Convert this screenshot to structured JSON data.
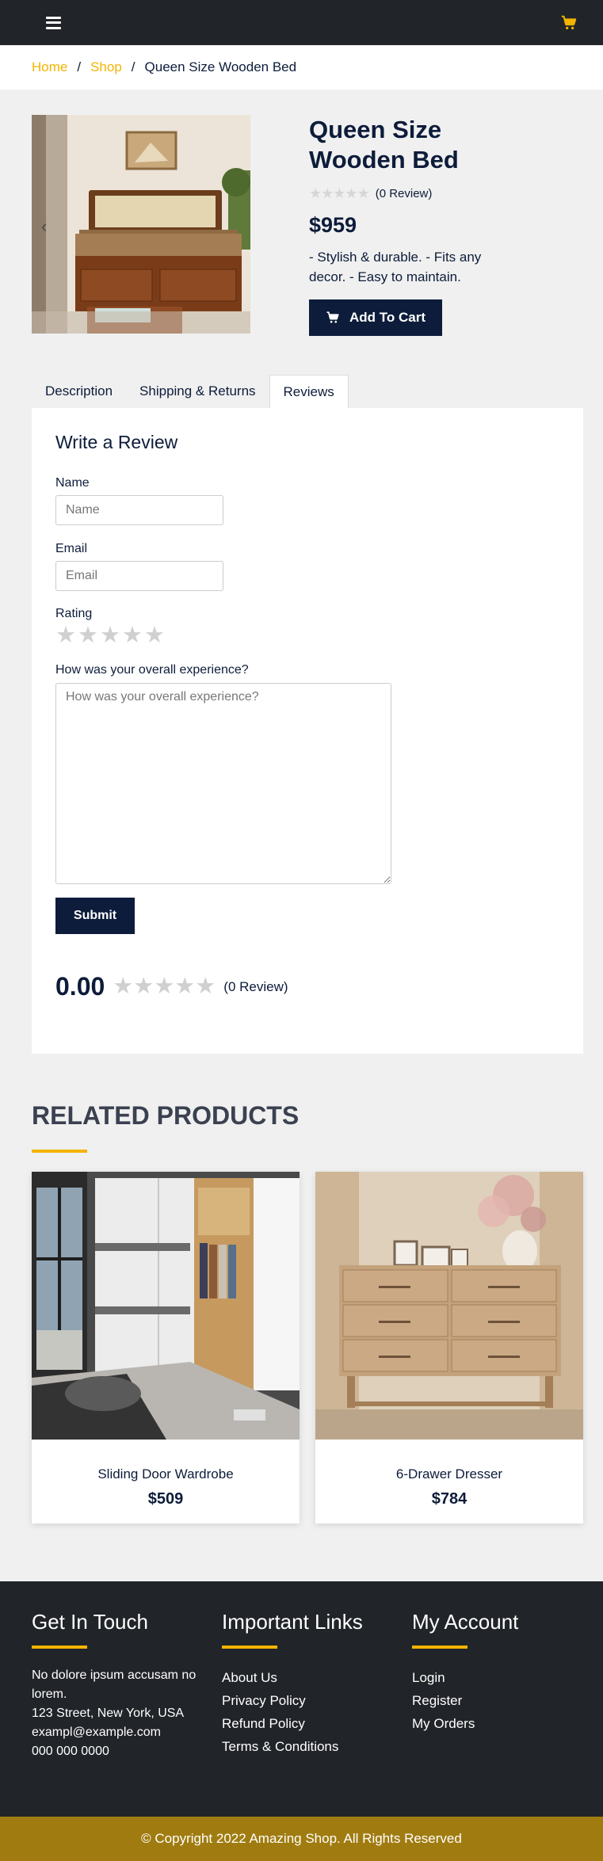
{
  "nav": {
    "menu_icon": "hamburger-menu-icon",
    "cart_icon": "shopping-cart-icon",
    "accent_color": "#f4b400",
    "dark_color": "#212428"
  },
  "breadcrumb": {
    "home": "Home",
    "shop": "Shop",
    "separator": "/",
    "current": "Queen Size Wooden Bed"
  },
  "product": {
    "title": "Queen Size Wooden Bed",
    "rating_stars": 0,
    "review_count": "(0 Review)",
    "price": "$959",
    "short_description": "- Stylish & durable. - Fits any decor. - Easy to maintain.",
    "add_to_cart": "Add To Cart",
    "prev_icon": "chevron-left-icon"
  },
  "tabs": [
    {
      "label": "Description",
      "active": false
    },
    {
      "label": "Shipping & Returns",
      "active": false
    },
    {
      "label": "Reviews",
      "active": true
    }
  ],
  "review_form": {
    "heading": "Write a Review",
    "name_label": "Name",
    "name_placeholder": "Name",
    "email_label": "Email",
    "email_placeholder": "Email",
    "rating_label": "Rating",
    "experience_label": "How was your overall experience?",
    "experience_placeholder": "How was your overall experience?",
    "submit": "Submit"
  },
  "review_summary": {
    "average": "0.00",
    "review_count": "(0 Review)"
  },
  "related": {
    "title": "RELATED PRODUCTS",
    "products": [
      {
        "name": "Sliding Door Wardrobe",
        "price": "$509"
      },
      {
        "name": "6-Drawer Dresser",
        "price": "$784"
      }
    ]
  },
  "footer": {
    "contact": {
      "heading": "Get In Touch",
      "address_line1": "No dolore ipsum accusam no lorem.",
      "address_line2": "123 Street, New York, USA",
      "email": "exampl@example.com",
      "phone": "000 000 0000"
    },
    "links": {
      "heading": "Important Links",
      "items": [
        "About Us",
        "Privacy Policy",
        "Refund Policy",
        "Terms & Conditions"
      ]
    },
    "account": {
      "heading": "My Account",
      "items": [
        "Login",
        "Register",
        "My Orders"
      ]
    },
    "copyright": "© Copyright 2022 Amazing Shop. All Rights Reserved"
  }
}
